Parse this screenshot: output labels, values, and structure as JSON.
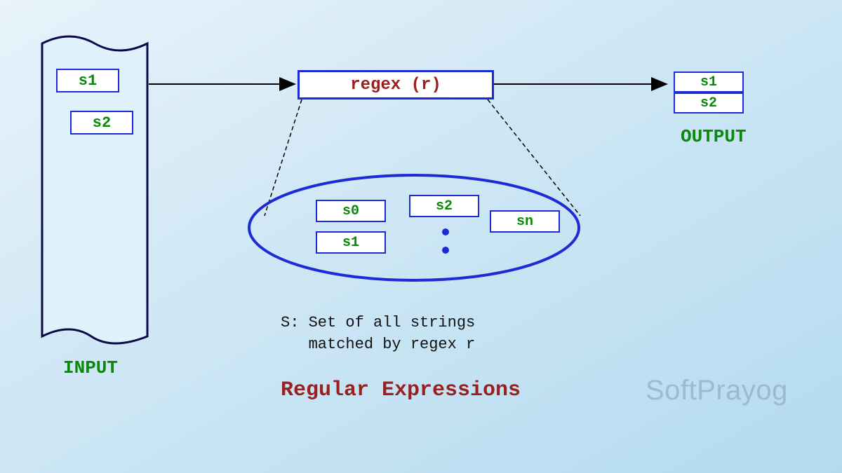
{
  "input": {
    "label": "INPUT",
    "items": [
      "s1",
      "s2"
    ]
  },
  "process": {
    "label": "regex (r)"
  },
  "output": {
    "label": "OUTPUT",
    "items": [
      "s1",
      "s2"
    ]
  },
  "set": {
    "caption_line1": "S: Set of all strings",
    "caption_line2": "   matched by regex r",
    "items": [
      "s0",
      "s1",
      "s2",
      "sn"
    ]
  },
  "title": "Regular Expressions",
  "watermark": "SoftPrayog",
  "colors": {
    "blue": "#1d2bd6",
    "green": "#0a8a0a",
    "red": "#9a1f1f"
  }
}
